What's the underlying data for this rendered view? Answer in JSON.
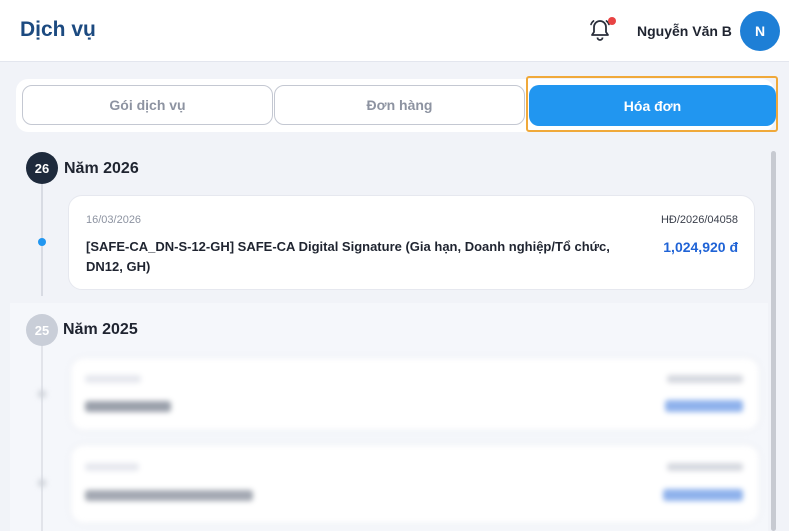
{
  "header": {
    "title": "Dịch vụ",
    "user_name": "Nguyễn Văn B",
    "avatar_initial": "N",
    "bell_icon": "bell-ring-icon"
  },
  "tabs": [
    {
      "label": "Gói dịch vụ",
      "active": false
    },
    {
      "label": "Đơn hàng",
      "active": false
    },
    {
      "label": "Hóa đơn",
      "active": true
    }
  ],
  "colors": {
    "brand": "#1c4a80",
    "accent": "#2196f0",
    "amount": "#1f63d6",
    "notification": "#e84343",
    "focus_outline": "#f0a93a"
  },
  "timeline": [
    {
      "badge": "26",
      "year_label": "Năm 2026",
      "invoices": [
        {
          "date": "16/03/2026",
          "code": "HĐ/2026/04058",
          "description": "[SAFE-CA_DN-S-12-GH] SAFE-CA Digital Signature (Gia hạn, Doanh nghiệp/Tổ chức, DN12, GH)",
          "amount": "1,024,920 đ"
        }
      ]
    },
    {
      "badge": "25",
      "year_label": "Năm 2025",
      "invoices": [
        {
          "date": "",
          "code": "",
          "description": "",
          "amount": ""
        },
        {
          "date": "",
          "code": "",
          "description": "",
          "amount": ""
        }
      ]
    }
  ]
}
